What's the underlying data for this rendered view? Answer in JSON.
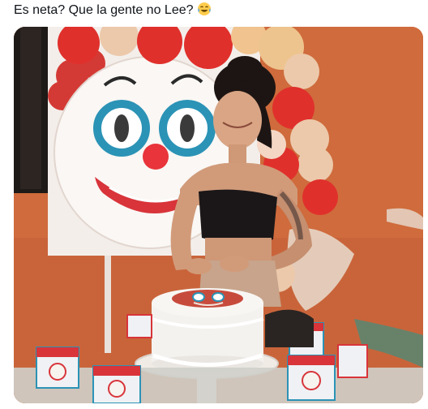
{
  "tweet": {
    "text": "Es neta? Que la gente no Lee?",
    "emoji_icon": "tears-of-joy-emoji-icon"
  },
  "media": {
    "type": "photo",
    "icons": {
      "clown_backdrop": "clown-face-icon",
      "balloon_arch": "balloon-icon",
      "cake": "cake-icon",
      "favor_boxes": "gift-box-icon"
    }
  },
  "colors": {
    "wall": "#d06a3a",
    "balloon_red": "#e0302c",
    "balloon_cream": "#ecc9ab",
    "clown_eye_ring": "#2b93b6",
    "clown_nose": "#e8343a",
    "cake_frosting": "#f4f2ef"
  }
}
